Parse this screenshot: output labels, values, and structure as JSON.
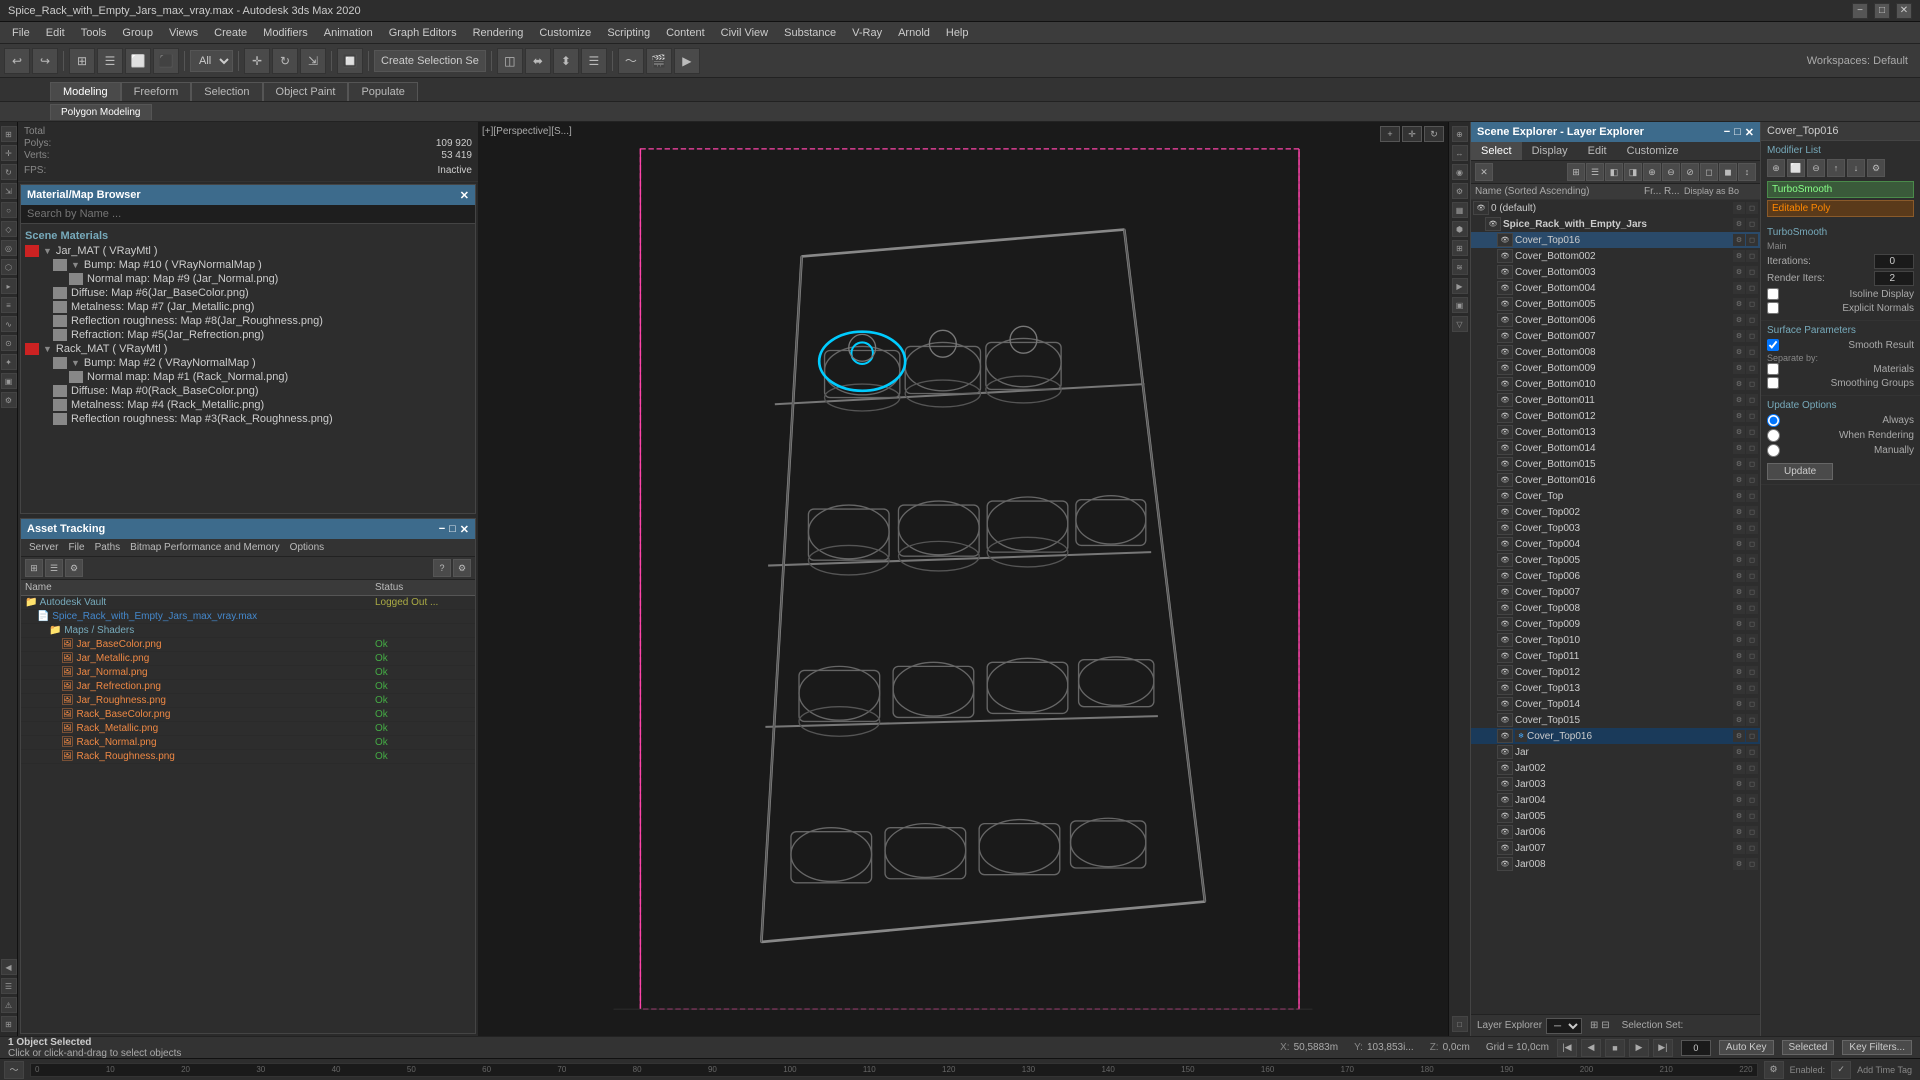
{
  "titleBar": {
    "title": "Spice_Rack_with_Empty_Jars_max_vray.max - Autodesk 3ds Max 2020",
    "minimize": "−",
    "maximize": "□",
    "close": "✕"
  },
  "menuBar": {
    "items": [
      "File",
      "Edit",
      "Tools",
      "Group",
      "Views",
      "Create",
      "Modifiers",
      "Animation",
      "Graph Editors",
      "Rendering",
      "Customize",
      "Scripting",
      "Content",
      "Civil View",
      "Substance",
      "V-Ray",
      "Arnold",
      "Help"
    ]
  },
  "toolbar": {
    "undoLabel": "↩",
    "redoLabel": "↪",
    "selectLabel": "All",
    "createSelectionLabel": "Create Selection Se",
    "workspacesLabel": "Workspaces: Default"
  },
  "tabs": {
    "items": [
      "Modeling",
      "Freeform",
      "Selection",
      "Object Paint",
      "Populate"
    ],
    "active": "Modeling",
    "subtabs": [
      "Polygon Modeling"
    ]
  },
  "materialBrowser": {
    "title": "Material/Map Browser",
    "searchPlaceholder": "Search by Name ...",
    "sectionLabel": "Scene Materials",
    "groups": [
      {
        "name": "Jar_MAT ( VRayMtl )",
        "expanded": true,
        "children": [
          {
            "name": "Bump: Map #10 ( VRayNormalMap )",
            "indent": 1,
            "expanded": true,
            "children": [
              {
                "name": "Normal map: Map #9 (Jar_Normal.png)",
                "indent": 2
              }
            ]
          },
          {
            "name": "Diffuse: Map #6(Jar_BaseColor.png)",
            "indent": 1
          },
          {
            "name": "Metalness: Map #7 (Jar_Metallic.png)",
            "indent": 1
          },
          {
            "name": "Reflection roughness: Map #8(Jar_Roughness.png)",
            "indent": 1
          },
          {
            "name": "Refraction: Map #5(Jar_Refrection.png)",
            "indent": 1
          }
        ]
      },
      {
        "name": "Rack_MAT ( VRayMtl )",
        "expanded": true,
        "children": [
          {
            "name": "Bump: Map #2 ( VRayNormalMap )",
            "indent": 1,
            "expanded": true,
            "children": [
              {
                "name": "Normal map: Map #1 (Rack_Normal.png)",
                "indent": 2
              }
            ]
          },
          {
            "name": "Diffuse: Map #0(Rack_BaseColor.png)",
            "indent": 1
          },
          {
            "name": "Metalness: Map #4 (Rack_Metallic.png)",
            "indent": 1
          },
          {
            "name": "Reflection roughness: Map #3(Rack_Roughness.png)",
            "indent": 1
          }
        ]
      }
    ]
  },
  "assetTracking": {
    "title": "Asset Tracking",
    "menus": [
      "Server",
      "File",
      "Paths",
      "Bitmap Performance and Memory",
      "Options"
    ],
    "columns": [
      "Name",
      "Status"
    ],
    "rows": [
      {
        "name": "Autodesk Vault",
        "status": "Logged Out ...",
        "indent": 0,
        "icon": "folder"
      },
      {
        "name": "Spice_Rack_with_Empty_Jars_max_vray.max",
        "status": "",
        "indent": 1,
        "icon": "file"
      },
      {
        "name": "Maps / Shaders",
        "status": "",
        "indent": 2,
        "icon": "folder"
      },
      {
        "name": "Jar_BaseColor.png",
        "status": "Ok",
        "indent": 3,
        "icon": "image"
      },
      {
        "name": "Jar_Metallic.png",
        "status": "Ok",
        "indent": 3,
        "icon": "image"
      },
      {
        "name": "Jar_Normal.png",
        "status": "Ok",
        "indent": 3,
        "icon": "image"
      },
      {
        "name": "Jar_Refrection.png",
        "status": "Ok",
        "indent": 3,
        "icon": "image"
      },
      {
        "name": "Jar_Roughness.png",
        "status": "Ok",
        "indent": 3,
        "icon": "image"
      },
      {
        "name": "Rack_BaseColor.png",
        "status": "Ok",
        "indent": 3,
        "icon": "image"
      },
      {
        "name": "Rack_Metallic.png",
        "status": "Ok",
        "indent": 3,
        "icon": "image"
      },
      {
        "name": "Rack_Normal.png",
        "status": "Ok",
        "indent": 3,
        "icon": "image"
      },
      {
        "name": "Rack_Roughness.png",
        "status": "Ok",
        "indent": 3,
        "icon": "image"
      }
    ]
  },
  "viewport": {
    "label": "[+][Perspective][S...]"
  },
  "sceneExplorer": {
    "title": "Scene Explorer - Layer Explorer",
    "tabs": [
      "Select",
      "Display",
      "Edit",
      "Customize"
    ],
    "activeTab": "Select",
    "columns": {
      "name": "Name (Sorted Ascending)",
      "fr": "Fr...",
      "ru": "R...",
      "display": "Display as Bo"
    },
    "treeItems": [
      {
        "name": "0 (default)",
        "indent": 0,
        "expanded": true
      },
      {
        "name": "Spice_Rack_with_Empty_Jars",
        "indent": 1,
        "expanded": true,
        "bold": true
      },
      {
        "name": "Cover_Top016",
        "indent": 2,
        "selected": true
      },
      {
        "name": "Cover_Bottom002",
        "indent": 2
      },
      {
        "name": "Cover_Bottom003",
        "indent": 2
      },
      {
        "name": "Cover_Bottom004",
        "indent": 2
      },
      {
        "name": "Cover_Bottom005",
        "indent": 2
      },
      {
        "name": "Cover_Bottom006",
        "indent": 2
      },
      {
        "name": "Cover_Bottom007",
        "indent": 2
      },
      {
        "name": "Cover_Bottom008",
        "indent": 2
      },
      {
        "name": "Cover_Bottom009",
        "indent": 2
      },
      {
        "name": "Cover_Bottom010",
        "indent": 2
      },
      {
        "name": "Cover_Bottom011",
        "indent": 2
      },
      {
        "name": "Cover_Bottom012",
        "indent": 2
      },
      {
        "name": "Cover_Bottom013",
        "indent": 2
      },
      {
        "name": "Cover_Bottom014",
        "indent": 2
      },
      {
        "name": "Cover_Bottom015",
        "indent": 2
      },
      {
        "name": "Cover_Bottom016",
        "indent": 2
      },
      {
        "name": "Cover_Top",
        "indent": 2
      },
      {
        "name": "Cover_Top002",
        "indent": 2
      },
      {
        "name": "Cover_Top003",
        "indent": 2
      },
      {
        "name": "Cover_Top004",
        "indent": 2
      },
      {
        "name": "Cover_Top005",
        "indent": 2
      },
      {
        "name": "Cover_Top006",
        "indent": 2
      },
      {
        "name": "Cover_Top007",
        "indent": 2
      },
      {
        "name": "Cover_Top008",
        "indent": 2
      },
      {
        "name": "Cover_Top009",
        "indent": 2
      },
      {
        "name": "Cover_Top010",
        "indent": 2
      },
      {
        "name": "Cover_Top011",
        "indent": 2
      },
      {
        "name": "Cover_Top012",
        "indent": 2
      },
      {
        "name": "Cover_Top013",
        "indent": 2
      },
      {
        "name": "Cover_Top014",
        "indent": 2
      },
      {
        "name": "Cover_Top015",
        "indent": 2
      },
      {
        "name": "Cover_Top016",
        "indent": 2,
        "highlighted": true,
        "hasSnow": true
      },
      {
        "name": "Jar",
        "indent": 2
      },
      {
        "name": "Jar002",
        "indent": 2
      },
      {
        "name": "Jar003",
        "indent": 2
      },
      {
        "name": "Jar004",
        "indent": 2
      },
      {
        "name": "Jar005",
        "indent": 2
      },
      {
        "name": "Jar006",
        "indent": 2
      },
      {
        "name": "Jar007",
        "indent": 2
      },
      {
        "name": "Jar008",
        "indent": 2
      }
    ],
    "layerExplorer": "Layer Explorer",
    "selectionSet": "Selection Set:"
  },
  "propertiesPanel": {
    "header": "Cover_Top016",
    "modifierList": "Modifier List",
    "modifiers": [
      {
        "name": "TurboSmooth",
        "type": "smooth"
      },
      {
        "name": "Editable Poly",
        "type": "orange"
      }
    ],
    "turboSmooth": {
      "title": "TurboSmooth",
      "main": "Main",
      "iterationsLabel": "Iterations:",
      "iterationsValue": "0",
      "renderItersLabel": "Render Iters:",
      "renderItersValue": "2",
      "isolineDisplay": "Isoline Display",
      "explicitNormals": "Explicit Normals"
    },
    "surfaceParams": {
      "title": "Surface Parameters",
      "smoothResult": "Smooth Result",
      "separateBy": "Separate by:",
      "materials": "Materials",
      "smoothingGroups": "Smoothing Groups"
    },
    "updateOptions": {
      "title": "Update Options",
      "always": "Always",
      "whenRendering": "When Rendering",
      "manually": "Manually",
      "updateBtn": "Update"
    }
  },
  "statusBar": {
    "message": "1 Object Selected",
    "hint": "Click or click-and-drag to select objects",
    "x": "X: 50,5883m",
    "y": "Y: 103,853i...",
    "z": "Z: 0,0cm",
    "grid": "Grid = 10,0cm",
    "selected": "Selected",
    "autoKey": "Auto Key",
    "addTimeTags": "Add Time Tag"
  },
  "bottomTimeline": {
    "labels": [
      "0",
      "10",
      "20",
      "30",
      "40",
      "50",
      "60",
      "70",
      "80",
      "90",
      "100",
      "110",
      "120",
      "130",
      "140",
      "150",
      "160",
      "170",
      "180",
      "190",
      "200",
      "210",
      "220"
    ],
    "keyFilters": "Key Filters..."
  }
}
